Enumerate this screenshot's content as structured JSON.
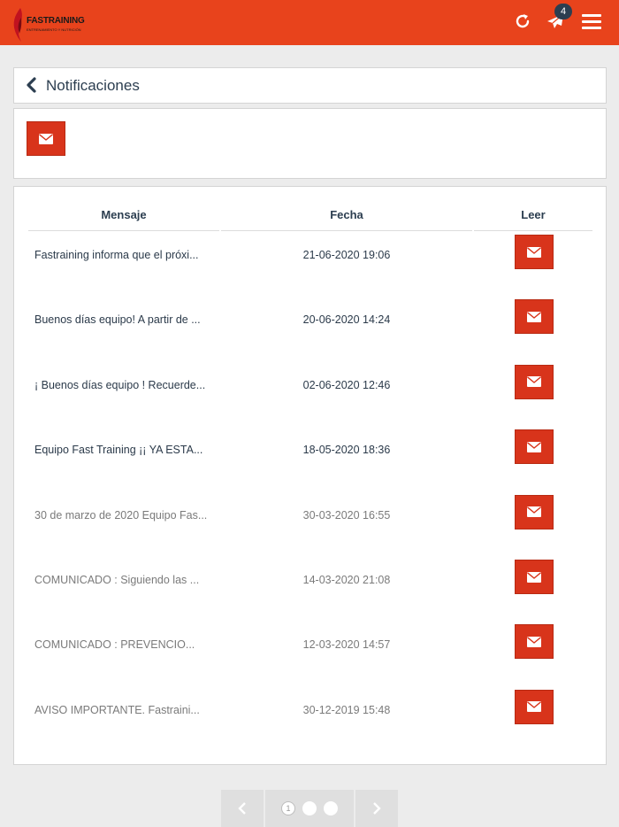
{
  "header": {
    "brand": "FASTRAINING",
    "tagline": "ENTRENAMIENTO Y NUTRICIÓN",
    "notification_count": "4",
    "bg_color": "#e8431c"
  },
  "title": {
    "label": "Notificaciones"
  },
  "table": {
    "headers": {
      "message": "Mensaje",
      "date": "Fecha",
      "read": "Leer"
    },
    "rows": [
      {
        "message": "Fastraining informa que el próxi...",
        "date": "21-06-2020 19:06",
        "read": false
      },
      {
        "message": "Buenos días equipo! A partir de ...",
        "date": "20-06-2020 14:24",
        "read": false
      },
      {
        "message": "¡ Buenos días equipo ! Recuerde...",
        "date": "02-06-2020 12:46",
        "read": false
      },
      {
        "message": "Equipo Fast Training ¡¡ YA ESTA...",
        "date": "18-05-2020 18:36",
        "read": false
      },
      {
        "message": "30 de marzo de 2020 Equipo Fas...",
        "date": "30-03-2020 16:55",
        "read": true
      },
      {
        "message": "COMUNICADO : Siguiendo las ...",
        "date": "14-03-2020 21:08",
        "read": true
      },
      {
        "message": "COMUNICADO : PREVENCIO...",
        "date": "12-03-2020 14:57",
        "read": true
      },
      {
        "message": "AVISO IMPORTANTE. Fastraini...",
        "date": "30-12-2019 15:48",
        "read": true
      }
    ]
  },
  "pagination": {
    "current_page": "1",
    "pages": 3
  },
  "icons": {
    "refresh": "refresh-icon",
    "send": "paper-plane-icon",
    "menu": "hamburger-menu-icon",
    "back": "chevron-left-icon",
    "envelope": "envelope-icon"
  },
  "colors": {
    "accent": "#e8431c",
    "button": "#d8341b",
    "title": "#2c3e50"
  }
}
